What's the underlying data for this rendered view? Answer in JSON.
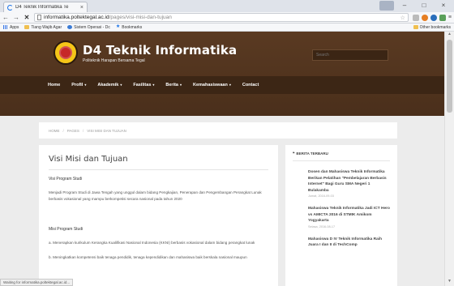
{
  "browser": {
    "tab_title": "D4 Teknik Informatika Te",
    "url_host": "informatika.poltektegal.ac.id",
    "url_path": "/pages/visi-misi-dan-tujuan",
    "bookmarks": [
      "Apps",
      "Tiang Wajib Agar",
      "Sistem Operasi - Dc",
      "Bookmarks"
    ],
    "other_bookmarks": "Other bookmarks",
    "status_text": "Waiting for informatika.poltektegal.ac.id..."
  },
  "site": {
    "title": "D4 Teknik Informatika",
    "subtitle": "Politeknik Harapan Bersama Tegal",
    "search_placeholder": "Search",
    "nav": [
      {
        "label": "Home",
        "caret": false
      },
      {
        "label": "Profil",
        "caret": true
      },
      {
        "label": "Akademik",
        "caret": true
      },
      {
        "label": "Fasilitas",
        "caret": true
      },
      {
        "label": "Berita",
        "caret": true
      },
      {
        "label": "Kemahasiswaan",
        "caret": true
      },
      {
        "label": "Contact",
        "caret": false
      }
    ]
  },
  "breadcrumb": [
    "HOME",
    "PAGES",
    "VISI MISI DAN TUJUAN"
  ],
  "main": {
    "title": "Visi Misi dan Tujuan",
    "visi_title": "Visi Program Studi",
    "visi_body": "Menjadi Program Studi di Jawa Tengah yang unggul dalam bidang Pengkajian, Penerapan dan Pengembangan Perangkat Lunak berbasis vokasional yang mampu berkompetisi secara nasional pada tahun 2020",
    "misi_title": "Misi Program Studi",
    "misi_a": "a. Menerapkan kurikulum Kerangka Kualifikasi Nasional Indonesia (KKNI) berbasis vokasional dalam bidang perangkat lunak",
    "misi_b": "b. Meningkatkan kompetensi baik tenaga pendidik, tenaga kependidikan dan mahasiswa baik berskala nasional maupun"
  },
  "sidebar": {
    "header": "BERITA TERBARU",
    "news": [
      {
        "title": "Dosen dan Mahasiswa Teknik Informatika Berikan Pelatihan \"Pembelajaran Berbasis Internet\" Bagi Guru SMA Negeri 1 Bulakamba",
        "date": "Jumat, 2016-09-03"
      },
      {
        "title": "Mahasiswa Teknik Informatika Jadi ICT Hero vs AMICTA 2016 di STMIK Amikom Yogyakarta",
        "date": "Selasa, 2016-08-17"
      },
      {
        "title": "Mahasiswa D IV Teknik Informatika Raih Juara I dan II di TechComp",
        "date": ""
      }
    ]
  },
  "colors": {
    "header_brown": "#5a3a22",
    "nav_brown": "#3c2615",
    "logo_yellow": "#f5c518"
  },
  "icons": {
    "back": "arrow-left-icon",
    "forward": "arrow-right-icon",
    "stop": "close-icon",
    "menu": "hamburger-icon",
    "bullet": "quote-icon"
  }
}
